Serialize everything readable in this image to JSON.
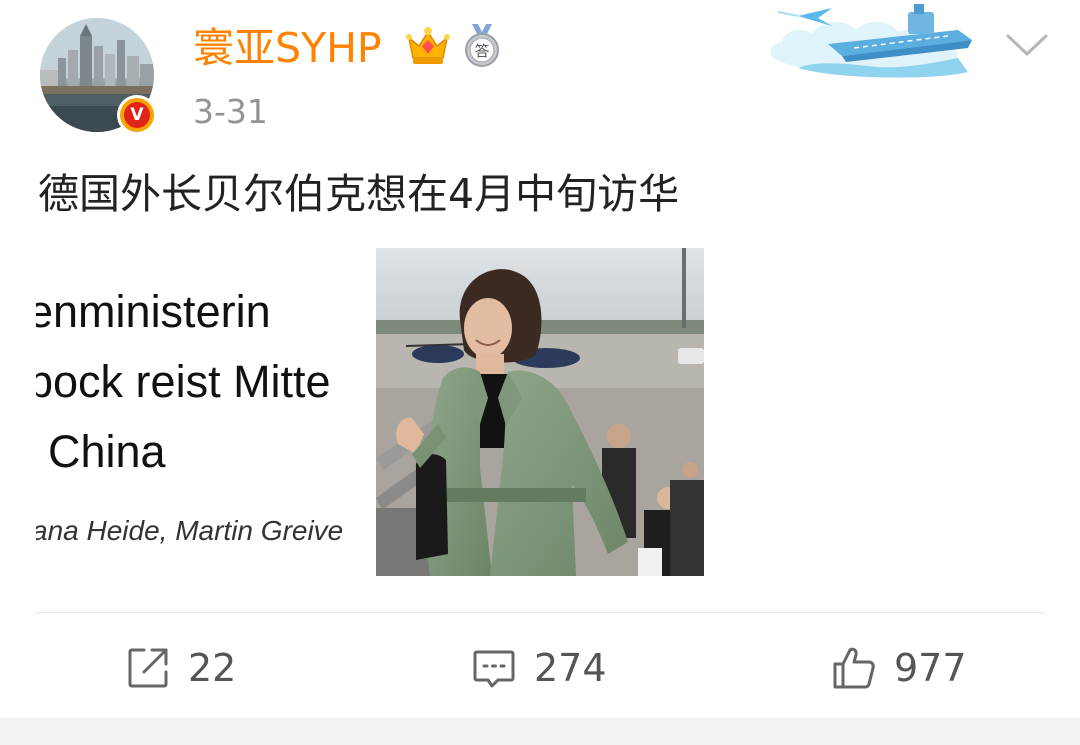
{
  "post": {
    "author": {
      "name": "寰亚SYHP",
      "avatar_icon": "city-skyline-avatar",
      "badge_letter": "V",
      "badge_icon": "verified-v-icon",
      "crown_icon": "vip-crown-icon",
      "medal_icon": "answer-medal-icon",
      "medal_text": "答"
    },
    "timestamp": "3-31",
    "text": "德国外长贝尔伯克想在4月中旬访华",
    "media": {
      "headline_lines": [
        "enministerin",
        "bock reist Mitte",
        "China"
      ],
      "byline": "ana Heide, Martin Greive",
      "photo_icon": "woman-boarding-plane-photo"
    },
    "actions": {
      "repost": {
        "icon": "repost-icon",
        "count": "22"
      },
      "comment": {
        "icon": "comment-icon",
        "count": "274"
      },
      "like": {
        "icon": "thumbs-up-icon",
        "count": "977"
      }
    },
    "menu_icon": "chevron-down-icon",
    "colors": {
      "username": "#ff8200",
      "timestamp": "#939393",
      "text": "#222222",
      "badge_outer": "#f7a400",
      "badge_inner": "#e2231a",
      "action_text": "#555555"
    }
  }
}
